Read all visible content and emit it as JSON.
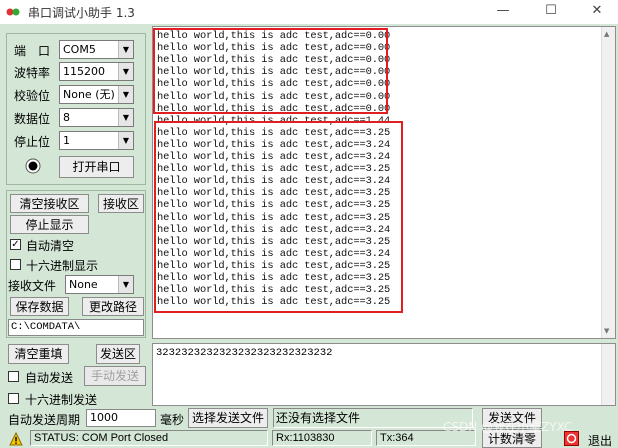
{
  "window": {
    "title": "串口调试小助手 1.3"
  },
  "titlebar": {
    "minimize": "—",
    "maximize": "☐",
    "close": "✕"
  },
  "settings": {
    "port_label": "端　口",
    "port_value": "COM5",
    "baud_label": "波特率",
    "baud_value": "115200",
    "parity_label": "校验位",
    "parity_value": "None (无)",
    "databits_label": "数据位",
    "databits_value": "8",
    "stopbits_label": "停止位",
    "stopbits_value": "1",
    "open_port_button": "打开串口"
  },
  "receive": {
    "clear_button": "清空接收区",
    "rx_area_button": "接收区",
    "stop_display_button": "停止显示",
    "auto_clear_label": "自动清空",
    "auto_clear_checked": true,
    "hex_display_label": "十六进制显示",
    "hex_display_checked": false,
    "rx_file_label": "接收文件",
    "rx_file_value": "None",
    "save_data_button": "保存数据",
    "change_path_button": "更改路径",
    "path": "C:\\COMDATA\\"
  },
  "rx_lines": [
    "hello world,this is adc test,adc==0.00",
    "hello world,this is adc test,adc==0.00",
    "hello world,this is adc test,adc==0.00",
    "hello world,this is adc test,adc==0.00",
    "hello world,this is adc test,adc==0.00",
    "hello world,this is adc test,adc==0.00",
    "hello world,this is adc test,adc==0.00",
    "hello world,this is adc test,adc==1.44",
    "hello world,this is adc test,adc==3.25",
    "hello world,this is adc test,adc==3.24",
    "hello world,this is adc test,adc==3.24",
    "hello world,this is adc test,adc==3.25",
    "hello world,this is adc test,adc==3.24",
    "hello world,this is adc test,adc==3.25",
    "hello world,this is adc test,adc==3.25",
    "hello world,this is adc test,adc==3.25",
    "hello world,this is adc test,adc==3.24",
    "hello world,this is adc test,adc==3.25",
    "hello world,this is adc test,adc==3.24",
    "hello world,this is adc test,adc==3.25",
    "hello world,this is adc test,adc==3.25",
    "hello world,this is adc test,adc==3.25",
    "hello world,this is adc test,adc==3.25"
  ],
  "send": {
    "clear_resend_button": "清空重填",
    "tx_area_button": "发送区",
    "auto_send_label": "自动发送",
    "auto_send_checked": false,
    "manual_send_button": "手动发送",
    "hex_send_label": "十六进制发送",
    "hex_send_checked": false,
    "period_label": "自动发送周期",
    "period_value": "1000",
    "ms_label": "毫秒",
    "select_file_button": "选择发送文件",
    "file_status": "还没有选择文件",
    "send_file_button": "发送文件",
    "tx_text": "3232323232323232323232323232"
  },
  "statusbar": {
    "status": "STATUS: COM Port Closed",
    "rx": "Rx:1103830",
    "tx": "Tx:364",
    "reset_count_button": "计数清零",
    "exit_button": "退出"
  },
  "watermark": "CSDN @我在小屋ZYXC",
  "colors": {
    "panel": "#d4e6d6",
    "highlight": "#e02020"
  }
}
